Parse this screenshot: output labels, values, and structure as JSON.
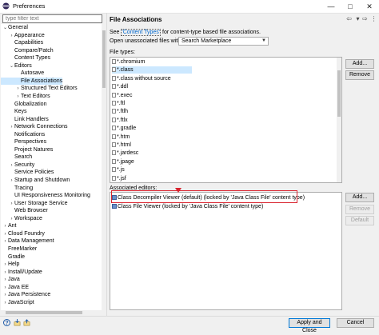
{
  "window": {
    "title": "Preferences"
  },
  "filter": {
    "placeholder": "type filter text"
  },
  "tree": [
    {
      "label": "General",
      "tw": "⌄",
      "indent": 0
    },
    {
      "label": "Appearance",
      "tw": "›",
      "indent": 1
    },
    {
      "label": "Capabilities",
      "tw": "",
      "indent": 1
    },
    {
      "label": "Compare/Patch",
      "tw": "",
      "indent": 1
    },
    {
      "label": "Content Types",
      "tw": "",
      "indent": 1
    },
    {
      "label": "Editors",
      "tw": "⌄",
      "indent": 1
    },
    {
      "label": "Autosave",
      "tw": "",
      "indent": 2
    },
    {
      "label": "File Associations",
      "tw": "",
      "indent": 2,
      "selected": true
    },
    {
      "label": "Structured Text Editors",
      "tw": "›",
      "indent": 2
    },
    {
      "label": "Text Editors",
      "tw": "›",
      "indent": 2
    },
    {
      "label": "Globalization",
      "tw": "",
      "indent": 1
    },
    {
      "label": "Keys",
      "tw": "",
      "indent": 1
    },
    {
      "label": "Link Handlers",
      "tw": "",
      "indent": 1
    },
    {
      "label": "Network Connections",
      "tw": "›",
      "indent": 1
    },
    {
      "label": "Notifications",
      "tw": "",
      "indent": 1
    },
    {
      "label": "Perspectives",
      "tw": "",
      "indent": 1
    },
    {
      "label": "Project Natures",
      "tw": "",
      "indent": 1
    },
    {
      "label": "Search",
      "tw": "",
      "indent": 1
    },
    {
      "label": "Security",
      "tw": "›",
      "indent": 1
    },
    {
      "label": "Service Policies",
      "tw": "",
      "indent": 1
    },
    {
      "label": "Startup and Shutdown",
      "tw": "›",
      "indent": 1
    },
    {
      "label": "Tracing",
      "tw": "",
      "indent": 1
    },
    {
      "label": "UI Responsiveness Monitoring",
      "tw": "",
      "indent": 1
    },
    {
      "label": "User Storage Service",
      "tw": "›",
      "indent": 1
    },
    {
      "label": "Web Browser",
      "tw": "",
      "indent": 1
    },
    {
      "label": "Workspace",
      "tw": "›",
      "indent": 1
    },
    {
      "label": "Ant",
      "tw": "›",
      "indent": 0
    },
    {
      "label": "Cloud Foundry",
      "tw": "›",
      "indent": 0
    },
    {
      "label": "Data Management",
      "tw": "›",
      "indent": 0
    },
    {
      "label": "FreeMarker",
      "tw": "",
      "indent": 0
    },
    {
      "label": "Gradle",
      "tw": "",
      "indent": 0
    },
    {
      "label": "Help",
      "tw": "›",
      "indent": 0
    },
    {
      "label": "Install/Update",
      "tw": "›",
      "indent": 0
    },
    {
      "label": "Java",
      "tw": "›",
      "indent": 0
    },
    {
      "label": "Java EE",
      "tw": "›",
      "indent": 0
    },
    {
      "label": "Java Persistence",
      "tw": "›",
      "indent": 0
    },
    {
      "label": "JavaScript",
      "tw": "›",
      "indent": 0
    }
  ],
  "page": {
    "title": "File Associations",
    "see_prefix": "See ",
    "see_link": "'Content Types'",
    "see_suffix": " for content-type based file associations.",
    "open_label": "Open unassociated files with:",
    "open_value": "Search Marketplace",
    "file_types_label": "File types:",
    "file_types": [
      "*.chromium",
      "*.class",
      "*.class without source",
      "*.ddl",
      "*.exec",
      "*.ftl",
      "*.ftlh",
      "*.ftlx",
      "*.gradle",
      "*.htm",
      "*.html",
      "*.jardesc",
      "*.jpage",
      "*.js",
      "*.jsf"
    ],
    "selected_file_type": 1,
    "associated_label": "Associated editors:",
    "editors": [
      "Class Decompiler Viewer (default) (locked by 'Java Class File' content type)",
      "Class File Viewer (locked by 'Java Class File' content type)"
    ]
  },
  "buttons": {
    "add_filetype": "Add...",
    "remove_filetype": "Remove",
    "add_editor": "Add...",
    "remove_editor": "Remove",
    "default_editor": "Default",
    "apply_close": "Apply and Close",
    "cancel": "Cancel"
  },
  "colors": {
    "selection": "#cce8ff",
    "highlight": "#d9232e",
    "link": "#0066cc"
  }
}
